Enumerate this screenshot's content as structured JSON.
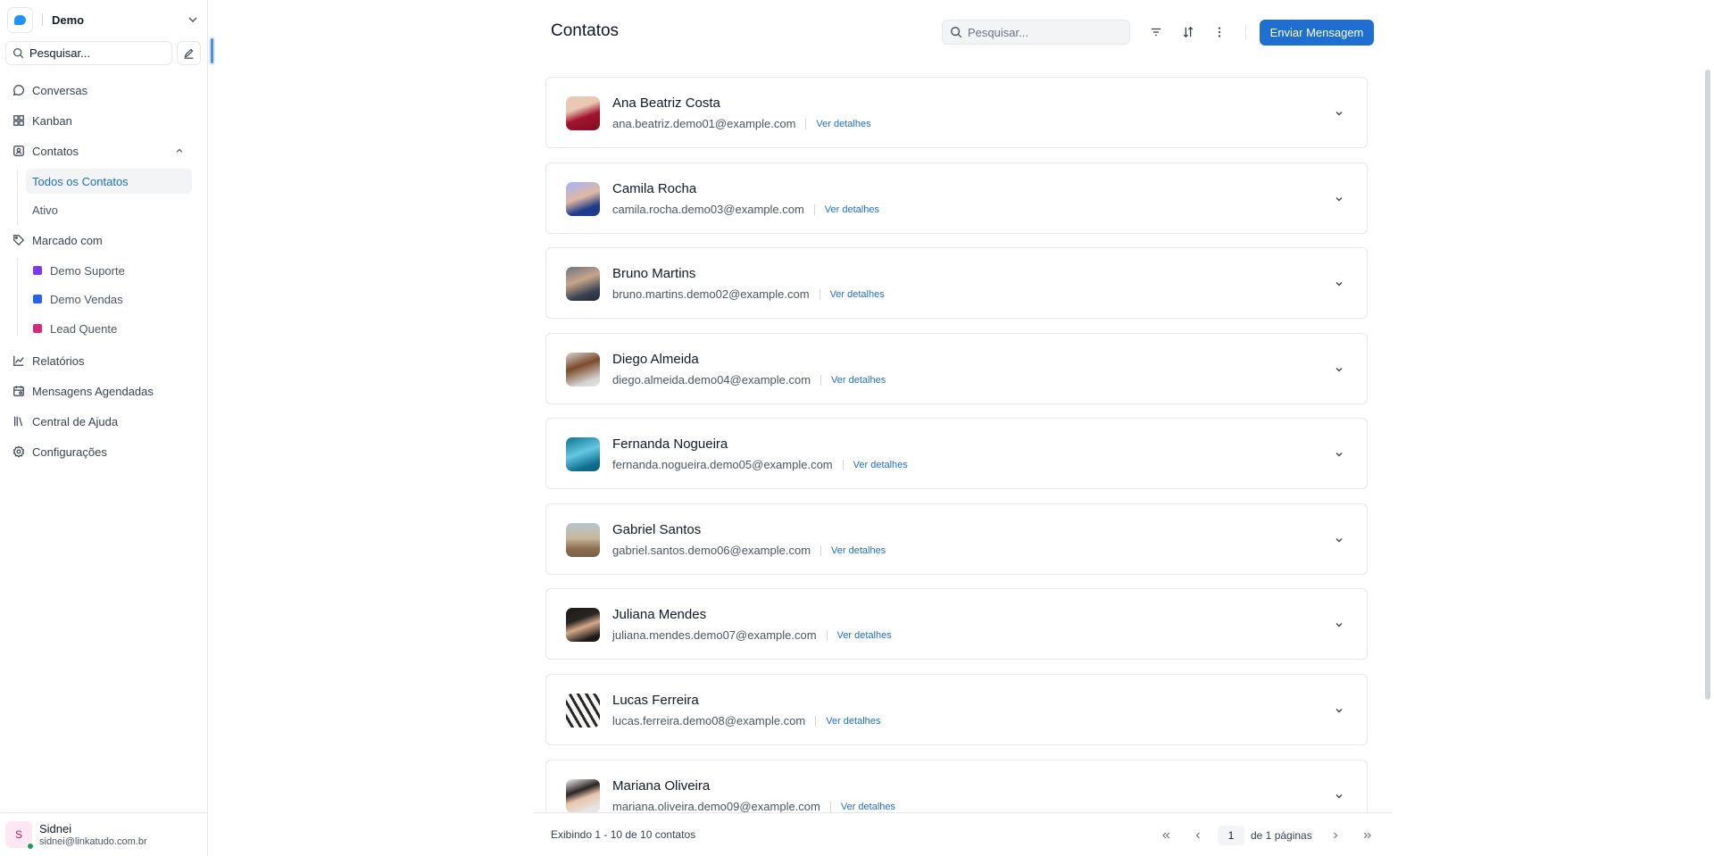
{
  "workspace": {
    "name": "Demo"
  },
  "sidebar": {
    "search_placeholder": "Pesquisar...",
    "items": [
      {
        "label": "Conversas",
        "icon": "chat-icon"
      },
      {
        "label": "Kanban",
        "icon": "kanban-icon"
      },
      {
        "label": "Contatos",
        "icon": "contacts-icon"
      },
      {
        "label": "Marcado com",
        "icon": "tag-icon"
      },
      {
        "label": "Relatórios",
        "icon": "chart-icon"
      },
      {
        "label": "Mensagens Agendadas",
        "icon": "calendar-icon"
      },
      {
        "label": "Central de Ajuda",
        "icon": "library-icon"
      },
      {
        "label": "Configurações",
        "icon": "gear-icon"
      }
    ],
    "contacts_sub": [
      {
        "label": "Todos os Contatos",
        "active": true
      },
      {
        "label": "Ativo",
        "active": false
      }
    ],
    "tags": [
      {
        "label": "Demo Suporte",
        "color": "#7c3aed"
      },
      {
        "label": "Demo Vendas",
        "color": "#2563eb"
      },
      {
        "label": "Lead Quente",
        "color": "#db2777"
      }
    ]
  },
  "user": {
    "initial": "S",
    "name": "Sidnei",
    "email": "sidnei@linkatudo.com.br"
  },
  "header": {
    "title": "Contatos",
    "search_placeholder": "Pesquisar...",
    "send_button": "Enviar Mensagem"
  },
  "contacts": [
    {
      "name": "Ana Beatriz Costa",
      "email": "ana.beatriz.demo01@example.com",
      "details_label": "Ver detalhes",
      "avatar_color": "#b91c3c"
    },
    {
      "name": "Camila Rocha",
      "email": "camila.rocha.demo03@example.com",
      "details_label": "Ver detalhes",
      "avatar_color": "#6d63c9"
    },
    {
      "name": "Bruno Martins",
      "email": "bruno.martins.demo02@example.com",
      "details_label": "Ver detalhes",
      "avatar_color": "#4b5563"
    },
    {
      "name": "Diego Almeida",
      "email": "diego.almeida.demo04@example.com",
      "details_label": "Ver detalhes",
      "avatar_color": "#57534e"
    },
    {
      "name": "Fernanda Nogueira",
      "email": "fernanda.nogueira.demo05@example.com",
      "details_label": "Ver detalhes",
      "avatar_color": "#1d8fb8"
    },
    {
      "name": "Gabriel Santos",
      "email": "gabriel.santos.demo06@example.com",
      "details_label": "Ver detalhes",
      "avatar_color": "#a68a64"
    },
    {
      "name": "Juliana Mendes",
      "email": "juliana.mendes.demo07@example.com",
      "details_label": "Ver detalhes",
      "avatar_color": "#292524"
    },
    {
      "name": "Lucas Ferreira",
      "email": "lucas.ferreira.demo08@example.com",
      "details_label": "Ver detalhes",
      "avatar_color": "#9ca3af"
    },
    {
      "name": "Mariana Oliveira",
      "email": "mariana.oliveira.demo09@example.com",
      "details_label": "Ver detalhes",
      "avatar_color": "#d6d3d1"
    }
  ],
  "footer": {
    "count_text": "Exibindo 1 - 10 de 10 contatos",
    "current_page": "1",
    "pages_text": "de 1 páginas"
  }
}
